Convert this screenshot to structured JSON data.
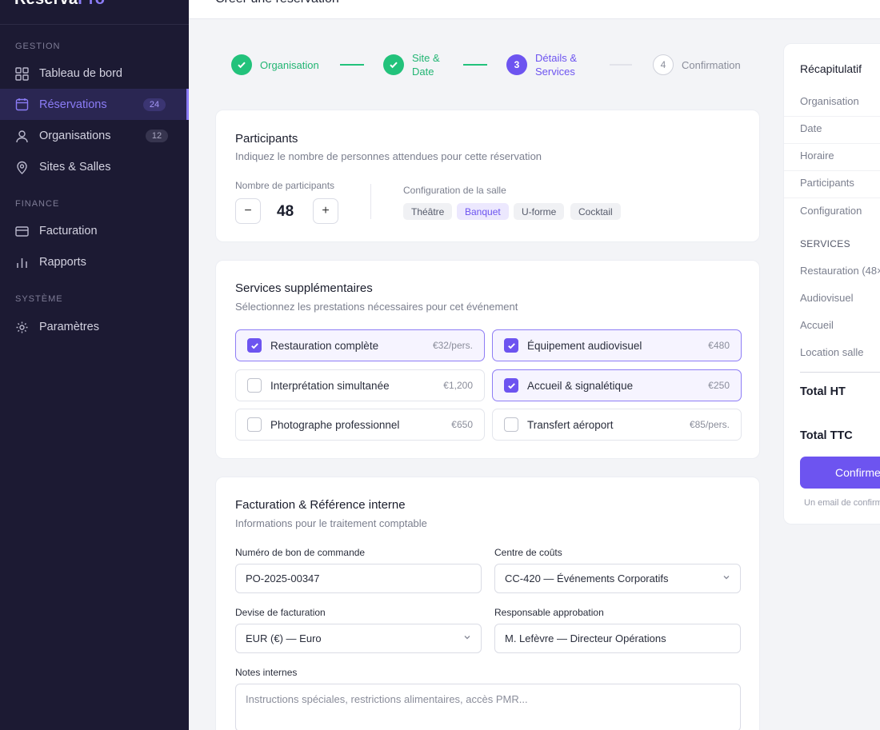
{
  "app": {
    "brand_main": "Réserva",
    "brand_accent": "Pro"
  },
  "header": {
    "title": "Créer une réservation"
  },
  "sidebar": {
    "sections": [
      {
        "label": "GESTION"
      },
      {
        "label": "FINANCE"
      },
      {
        "label": "SYSTÈME"
      }
    ],
    "items": [
      {
        "label": "Tableau de bord",
        "icon": "grid-icon"
      },
      {
        "label": "Réservations",
        "icon": "calendar-icon",
        "count": "24",
        "active": true
      },
      {
        "label": "Organisations",
        "icon": "user-icon",
        "count": "12"
      },
      {
        "label": "Sites & Salles",
        "icon": "map-pin-icon"
      },
      {
        "label": "Facturation",
        "icon": "credit-card-icon"
      },
      {
        "label": "Rapports",
        "icon": "bar-chart-icon"
      },
      {
        "label": "Paramètres",
        "icon": "settings-icon"
      }
    ]
  },
  "stepper": {
    "steps": [
      {
        "num": "1",
        "line1": "Organisation",
        "line2": "",
        "state": "done"
      },
      {
        "num": "2",
        "line1": "Site &",
        "line2": "Date",
        "state": "done"
      },
      {
        "num": "3",
        "line1": "Détails &",
        "line2": "Services",
        "state": "current"
      },
      {
        "num": "4",
        "line1": "Confirmation",
        "line2": "",
        "state": "todo"
      }
    ]
  },
  "participants": {
    "title": "Participants",
    "subtitle": "Indiquez le nombre de personnes attendues pour cette réservation",
    "count_label": "Nombre de participants",
    "count": "48",
    "minus": "−",
    "plus": "+",
    "config_label": "Configuration de la salle",
    "configs": [
      {
        "label": "Théâtre",
        "selected": false
      },
      {
        "label": "Banquet",
        "selected": true
      },
      {
        "label": "U-forme",
        "selected": false
      },
      {
        "label": "Cocktail",
        "selected": false
      }
    ]
  },
  "services": {
    "title": "Services supplémentaires",
    "subtitle": "Sélectionnez les prestations nécessaires pour cet événement",
    "items": [
      {
        "label": "Restauration complète",
        "price": "€32/pers.",
        "checked": true
      },
      {
        "label": "Équipement audiovisuel",
        "price": "€480",
        "checked": true
      },
      {
        "label": "Interprétation simultanée",
        "price": "€1,200",
        "checked": false
      },
      {
        "label": "Accueil & signalétique",
        "price": "€250",
        "checked": true
      },
      {
        "label": "Photographe professionnel",
        "price": "€650",
        "checked": false
      },
      {
        "label": "Transfert aéroport",
        "price": "€85/pers.",
        "checked": false
      }
    ]
  },
  "billing": {
    "title": "Facturation & Référence interne",
    "subtitle": "Informations pour le traitement comptable",
    "po_label": "Numéro de bon de commande",
    "po_value": "PO-2025-00347",
    "cost_center_label": "Centre de coûts",
    "cost_center_value": "CC-420 — Événements Corporatifs",
    "currency_label": "Devise de facturation",
    "currency_value": "EUR (€) — Euro",
    "approver_label": "Responsable approbation",
    "approver_value": "M. Lefèvre — Directeur Opérations",
    "notes_label": "Notes internes",
    "notes_placeholder": "Instructions spéciales, restrictions alimentaires, accès PMR..."
  },
  "summary": {
    "title": "Récapitulatif",
    "rows": [
      "Organisation",
      "Date",
      "Horaire",
      "Participants",
      "Configuration"
    ],
    "services_header": "SERVICES",
    "service_rows": [
      "Restauration (48×",
      "Audiovisuel",
      "Accueil",
      "Location salle"
    ],
    "total_ht": "Total HT",
    "total_ttc": "Total TTC",
    "confirm": "Confirmer",
    "note": "Un email de confirmation"
  },
  "colors": {
    "accent": "#6d54f0",
    "success": "#22c27b",
    "sidebar_bg": "#1c1a33"
  }
}
